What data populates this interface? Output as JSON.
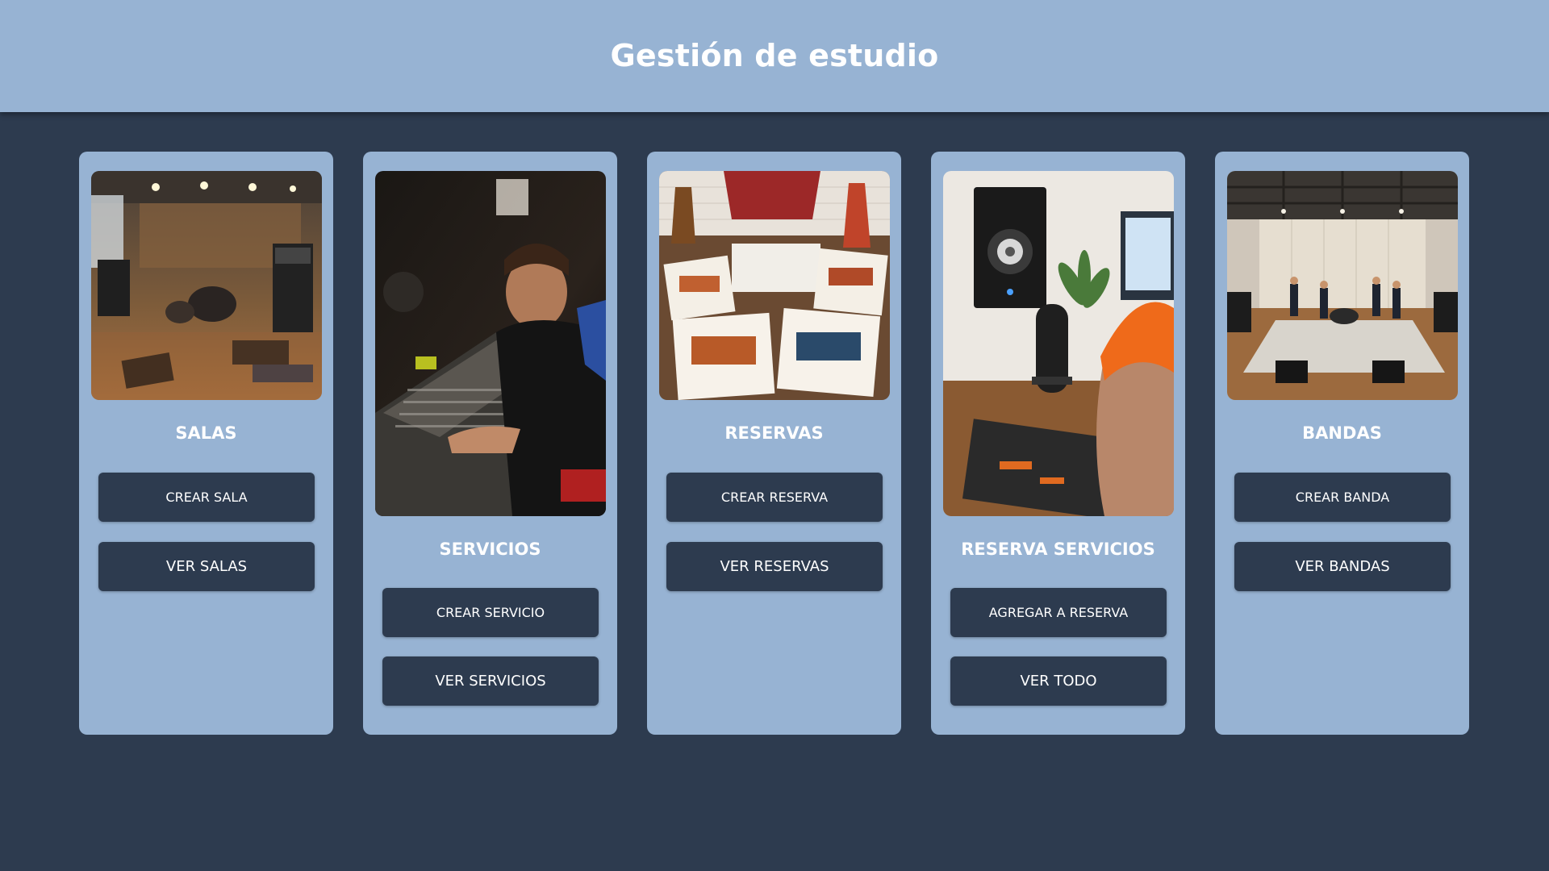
{
  "header": {
    "title": "Gestión de estudio"
  },
  "colors": {
    "header_bg": "#97b3d3",
    "page_bg": "#2d3b4f",
    "card_bg": "#97b3d3",
    "button_bg": "#2d3b4f",
    "text": "#ffffff"
  },
  "cards": [
    {
      "title": "SALAS",
      "image": "rehearsal-room-photo",
      "buttons": [
        {
          "label": "CREAR SALA"
        },
        {
          "label": "VER SALAS"
        }
      ]
    },
    {
      "title": "SERVICIOS",
      "image": "sound-engineer-mixing-photo",
      "buttons": [
        {
          "label": "CREAR SERVICIO"
        },
        {
          "label": "VER SERVICIOS"
        }
      ]
    },
    {
      "title": "RESERVAS",
      "image": "booking-papers-photo",
      "buttons": [
        {
          "label": "CREAR RESERVA"
        },
        {
          "label": "VER RESERVAS"
        }
      ]
    },
    {
      "title": "RESERVA SERVICIOS",
      "image": "home-studio-microphone-photo",
      "buttons": [
        {
          "label": "AGREGAR A RESERVA"
        },
        {
          "label": "VER TODO"
        }
      ]
    },
    {
      "title": "BANDAS",
      "image": "band-playing-photo",
      "buttons": [
        {
          "label": "CREAR BANDA"
        },
        {
          "label": "VER BANDAS"
        }
      ]
    }
  ]
}
